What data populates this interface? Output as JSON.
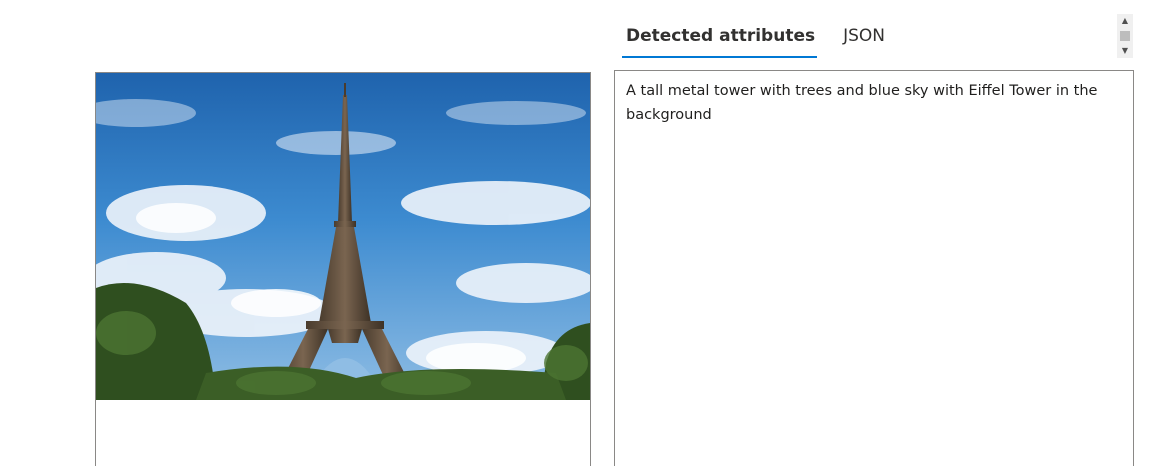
{
  "tabs": [
    {
      "label": "Detected attributes",
      "active": true
    },
    {
      "label": "JSON",
      "active": false
    }
  ],
  "result": {
    "caption": "A tall metal tower with trees and blue sky with Eiffel Tower in the background"
  },
  "image": {
    "subject": "Eiffel Tower under blue sky with clouds and trees"
  },
  "colors": {
    "accent": "#0078d4",
    "border": "#8a8886",
    "sky": "#2f78c0"
  }
}
